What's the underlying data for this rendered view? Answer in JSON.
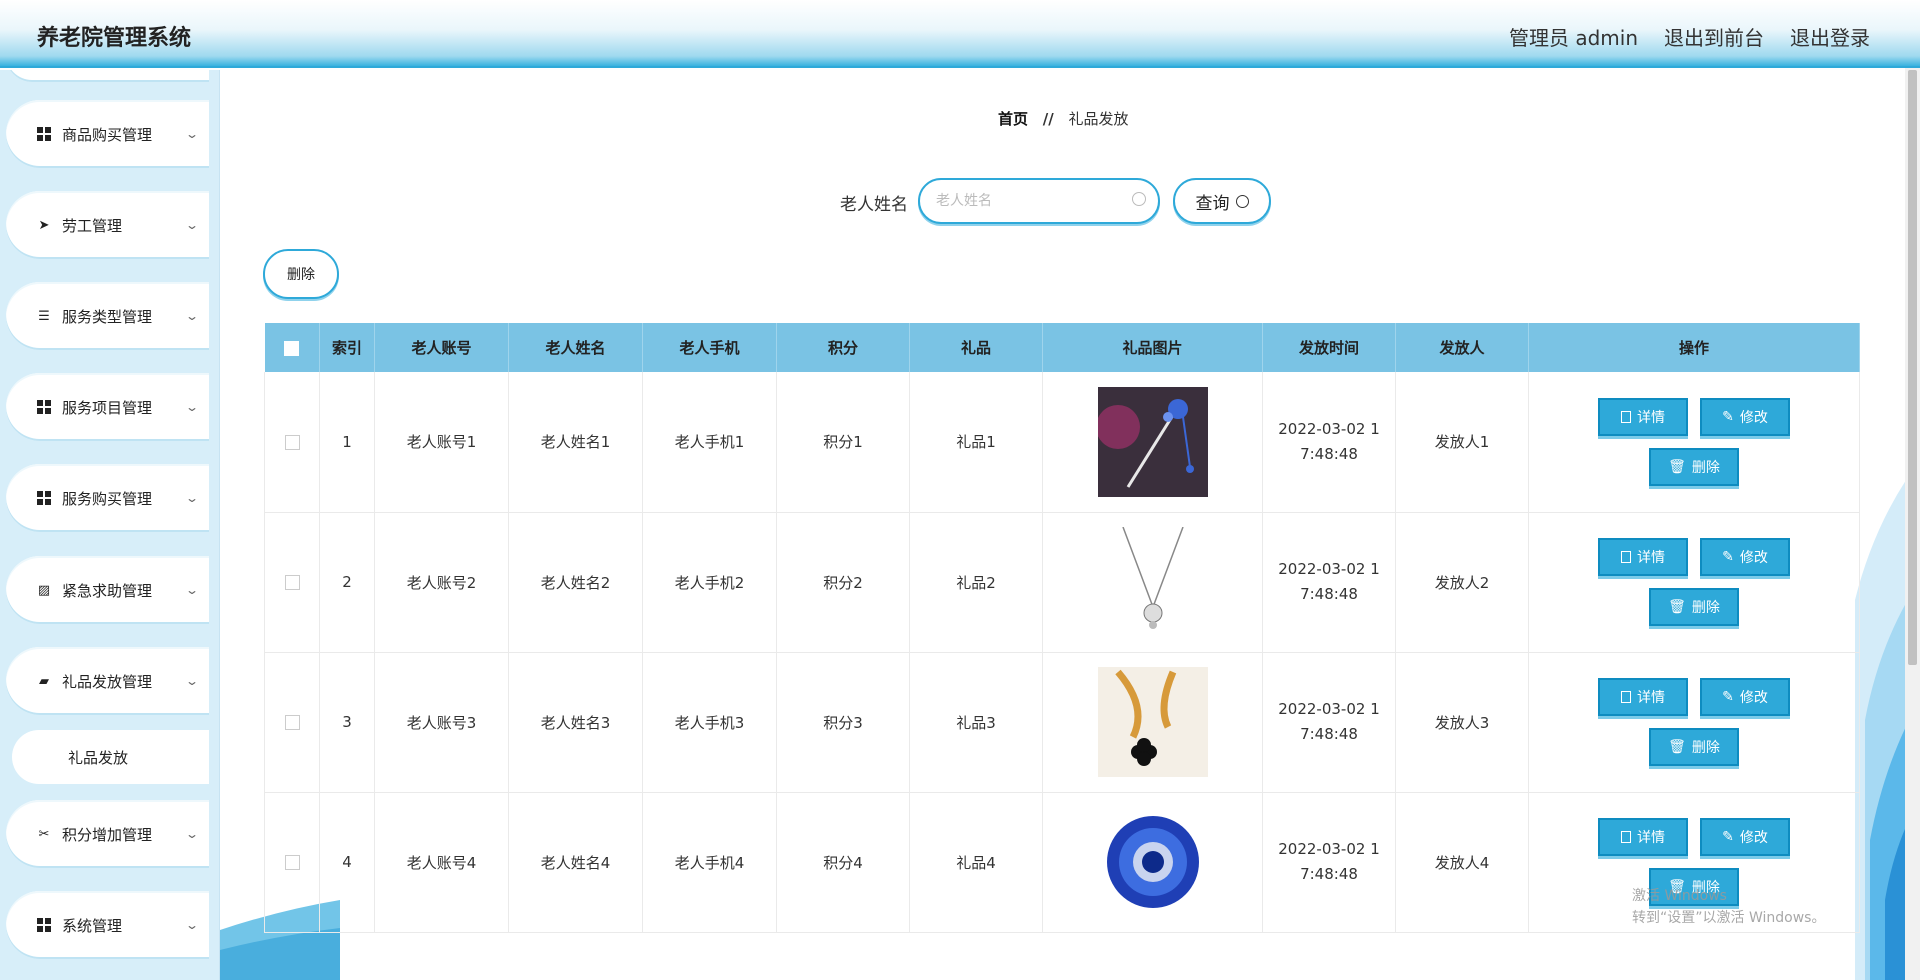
{
  "header": {
    "title": "养老院管理系统",
    "admin": "管理员 admin",
    "front": "退出到前台",
    "logout": "退出登录"
  },
  "sidebar": {
    "items": [
      {
        "label": "商品购买管理",
        "icon": "grid-icon"
      },
      {
        "label": "劳工管理",
        "icon": "send-icon"
      },
      {
        "label": "服务类型管理",
        "icon": "list-icon"
      },
      {
        "label": "服务项目管理",
        "icon": "grid-icon"
      },
      {
        "label": "服务购买管理",
        "icon": "grid-icon"
      },
      {
        "label": "紧急求助管理",
        "icon": "chart-icon"
      },
      {
        "label": "礼品发放管理",
        "icon": "wallet-icon"
      },
      {
        "label": "积分增加管理",
        "icon": "ticket-icon"
      },
      {
        "label": "系统管理",
        "icon": "grid-icon"
      }
    ],
    "sub_item": "礼品发放"
  },
  "breadcrumb": {
    "home": "首页",
    "sep": "//",
    "current": "礼品发放"
  },
  "search": {
    "label": "老人姓名",
    "placeholder": "老人姓名",
    "value": "",
    "button": "查询"
  },
  "toolbar": {
    "delete": "删除"
  },
  "table": {
    "columns": [
      "索引",
      "老人账号",
      "老人姓名",
      "老人手机",
      "积分",
      "礼品",
      "礼品图片",
      "发放时间",
      "发放人",
      "操作"
    ],
    "rows": [
      {
        "idx": "1",
        "account": "老人账号1",
        "name": "老人姓名1",
        "phone": "老人手机1",
        "points": "积分1",
        "gift": "礼品1",
        "time1": "2022-03-02 1",
        "time2": "7:48:48",
        "issuer": "发放人1"
      },
      {
        "idx": "2",
        "account": "老人账号2",
        "name": "老人姓名2",
        "phone": "老人手机2",
        "points": "积分2",
        "gift": "礼品2",
        "time1": "2022-03-02 1",
        "time2": "7:48:48",
        "issuer": "发放人2"
      },
      {
        "idx": "3",
        "account": "老人账号3",
        "name": "老人姓名3",
        "phone": "老人手机3",
        "points": "积分3",
        "gift": "礼品3",
        "time1": "2022-03-02 1",
        "time2": "7:48:48",
        "issuer": "发放人3"
      },
      {
        "idx": "4",
        "account": "老人账号4",
        "name": "老人姓名4",
        "phone": "老人手机4",
        "points": "积分4",
        "gift": "礼品4",
        "time1": "2022-03-02 1",
        "time2": "7:48:48",
        "issuer": "发放人4"
      }
    ],
    "actions": {
      "detail": "详情",
      "edit": "修改",
      "delete": "删除"
    }
  },
  "watermark": {
    "line1": "激活 Windows",
    "line2": "转到“设置”以激活 Windows。"
  },
  "colors": {
    "accent": "#2ea9d9",
    "header_row": "#7ac3e4",
    "sidebar_bg": "#d7eef9"
  }
}
